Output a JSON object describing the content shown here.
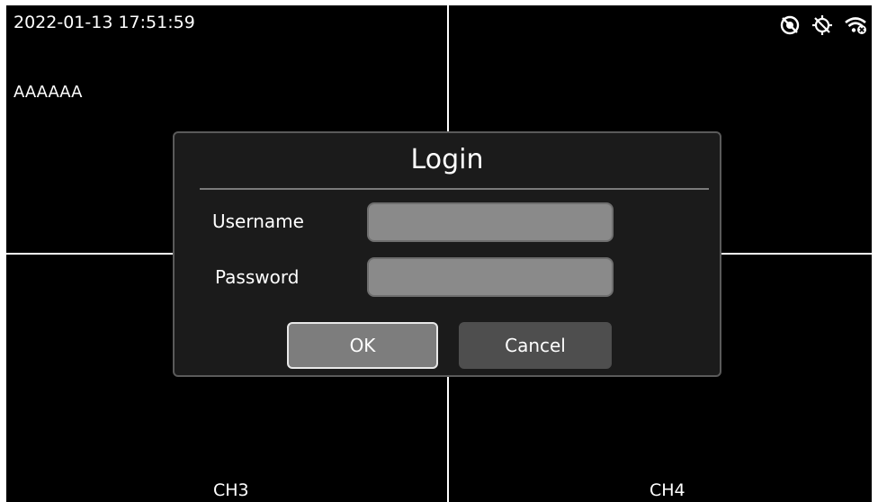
{
  "overlay": {
    "timestamp": "2022-01-13 17:51:59",
    "osd_text": "AAAAAA"
  },
  "channels": {
    "ch3_label": "CH3",
    "ch4_label": "CH4"
  },
  "status_icons": [
    "recording-off-icon",
    "gps-off-icon",
    "wifi-off-icon"
  ],
  "login_dialog": {
    "title": "Login",
    "username_label": "Username",
    "username_value": "",
    "password_label": "Password",
    "password_value": "",
    "ok_label": "OK",
    "cancel_label": "Cancel"
  },
  "colors": {
    "background": "#000000",
    "grid_line": "#ffffff",
    "dialog_bg": "#1b1b1b",
    "input_bg": "#8a8a8a",
    "ok_button": "#7d7d7d",
    "cancel_button": "#4e4e4e"
  }
}
